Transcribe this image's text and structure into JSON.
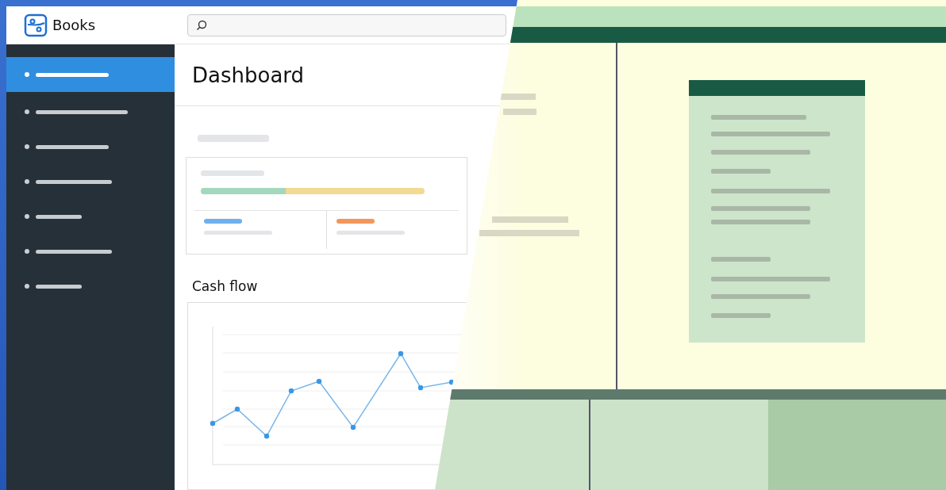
{
  "app": {
    "name": "Books"
  },
  "summary": {
    "progress": {
      "level": 0.38
    }
  },
  "sidebar": {
    "items": [
      {
        "selected": true
      },
      {
        "selected": false
      },
      {
        "selected": false
      },
      {
        "selected": false
      },
      {
        "selected": false
      },
      {
        "selected": false
      },
      {
        "selected": false
      }
    ]
  },
  "page": {
    "title": "Dashboard"
  },
  "cash_flow": {
    "title": "Cash flow"
  }
}
